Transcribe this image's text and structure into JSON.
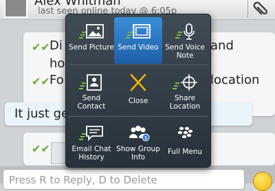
{
  "header": {
    "contact_name": "Alex Whitman",
    "last_seen": "last seen online today @ 6:05p"
  },
  "chat": {
    "messages": [
      {
        "text": "Di",
        "tail": "and"
      },
      {
        "text": "ho",
        "tail": ""
      },
      {
        "text": "Fo",
        "tail": "location"
      },
      {
        "text": "It just ge",
        "tail": ""
      }
    ]
  },
  "menu": {
    "items": [
      {
        "label": "Send Picture",
        "icon": "picture-icon"
      },
      {
        "label": "Send Video",
        "icon": "video-icon",
        "selected": true
      },
      {
        "label": "Send Voice Note",
        "icon": "microphone-icon"
      },
      {
        "label": "Send Contact",
        "icon": "contact-icon"
      },
      {
        "label": "Close",
        "icon": "close-icon"
      },
      {
        "label": "Share Location",
        "icon": "crosshair-icon"
      },
      {
        "label": "Email Chat History",
        "icon": "chat-history-icon"
      },
      {
        "label": "Show Group Info",
        "icon": "group-info-icon"
      },
      {
        "label": "Full Menu",
        "icon": "blackberry-icon"
      }
    ]
  },
  "composer": {
    "placeholder": "Press R to Reply, D to Delete"
  },
  "colors": {
    "menu_bg": "#2f3a44",
    "selected": "#2a7bd0",
    "tick": "#6cab3c",
    "close_x": "#f0b400"
  }
}
